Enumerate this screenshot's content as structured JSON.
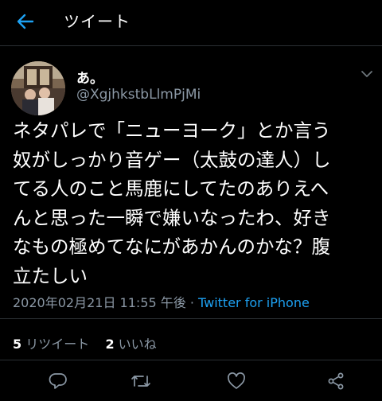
{
  "header": {
    "title": "ツイート"
  },
  "tweet": {
    "display_name": "あ。",
    "handle": "@XgjhkstbLlmPjMi",
    "text": "ネタパレで「ニューヨーク」とか言う\n奴がしっかり音ゲー（太鼓の達人）し\nてる人のこと馬鹿にしてたのありえへ\nんと思った一瞬で嫌いなったわ、好き\nなもの極めてなにがあかんのかな？腹\n立たしい",
    "timestamp": "2020年02月21日 11:55 午後",
    "separator": " · ",
    "source": "Twitter for iPhone"
  },
  "stats": {
    "retweets_count": "5",
    "retweets_label": "リツイート",
    "likes_count": "2",
    "likes_label": "いいね"
  },
  "icons": [
    "back-arrow-icon",
    "chevron-down-icon",
    "reply-icon",
    "retweet-icon",
    "like-icon",
    "share-icon"
  ],
  "colors": {
    "background": "#000000",
    "accent": "#1da1f2",
    "secondary_text": "#8b98a5",
    "divider": "#2a2f33"
  }
}
